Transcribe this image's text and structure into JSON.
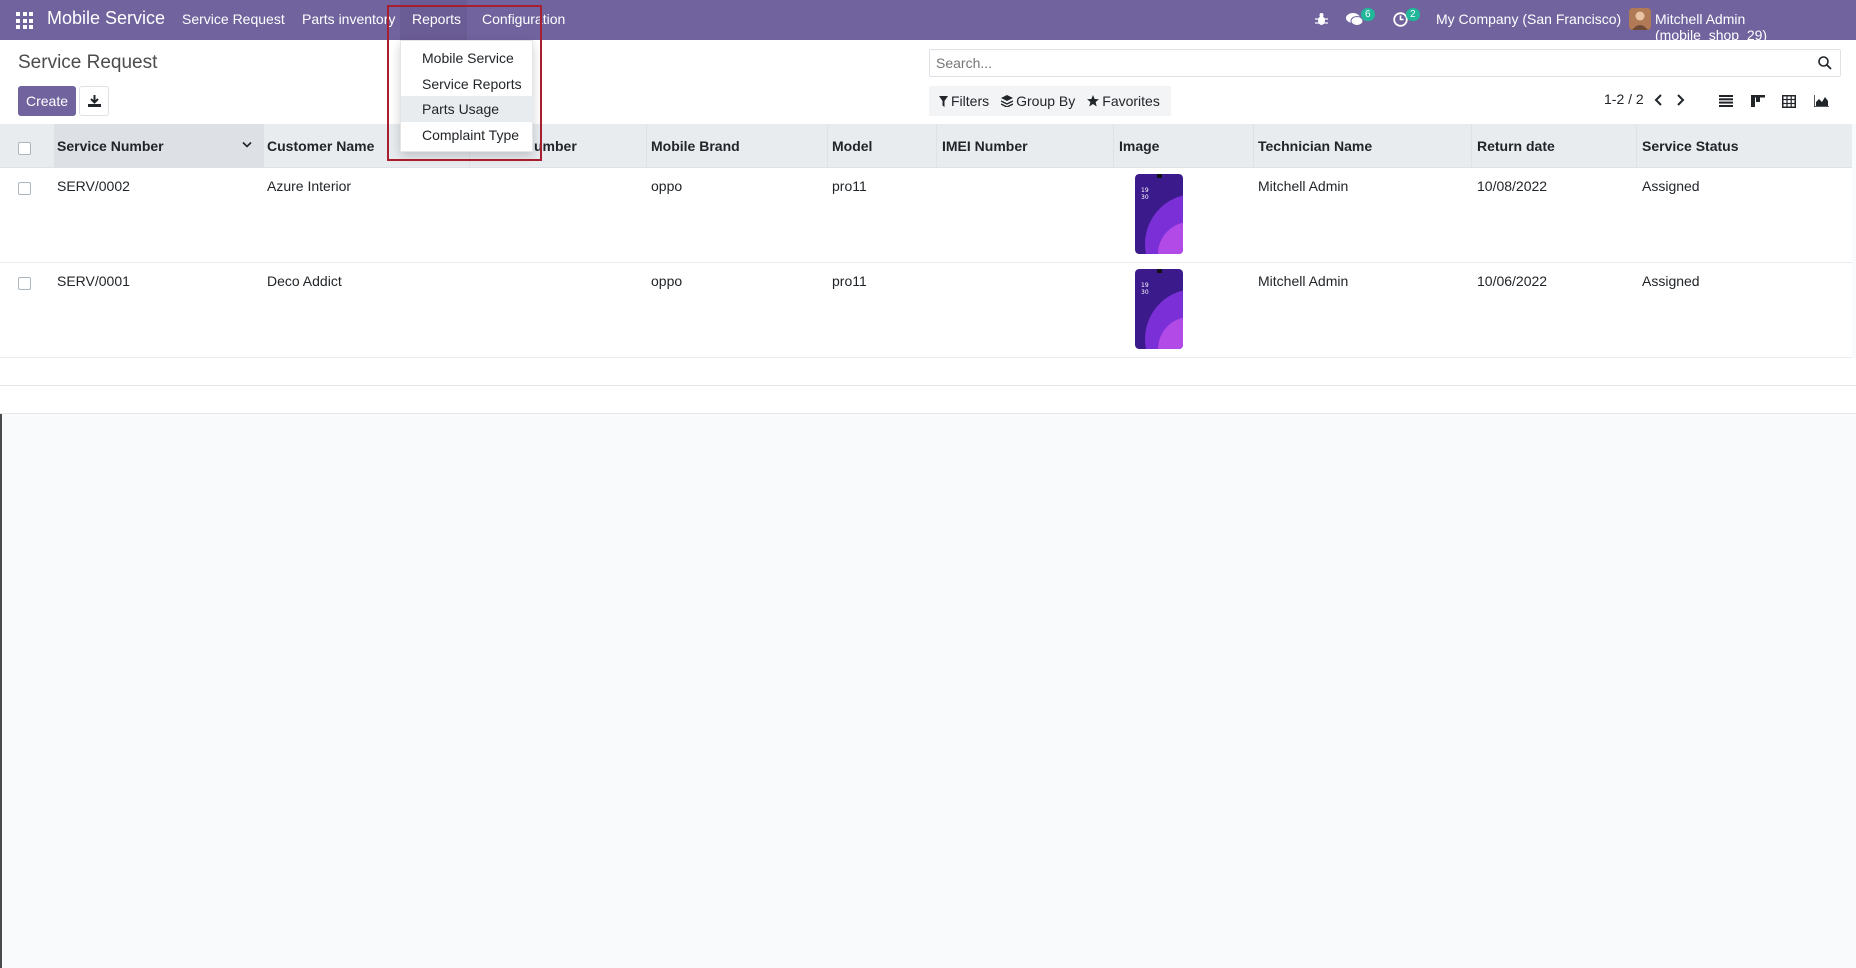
{
  "navbar": {
    "app_name": "Mobile Service",
    "menus": [
      "Service Request",
      "Parts inventory",
      "Reports",
      "Configuration"
    ],
    "messages_count": "6",
    "activities_count": "2",
    "company": "My Company (San Francisco)",
    "user": "Mitchell Admin (mobile_shop_29)"
  },
  "reports_menu": {
    "items": [
      "Mobile Service",
      "Service Reports",
      "Parts Usage",
      "Complaint Type"
    ],
    "hovered": "Parts Usage"
  },
  "control_panel": {
    "title": "Service Request",
    "create_label": "Create",
    "search_placeholder": "Search...",
    "filters_label": "Filters",
    "group_by_label": "Group By",
    "favorites_label": "Favorites",
    "pager": "1-2 / 2"
  },
  "table": {
    "columns": [
      "Service Number",
      "Customer Name",
      "umber",
      "Mobile Brand",
      "Model",
      "IMEI Number",
      "Image",
      "Technician Name",
      "Return date",
      "Service Status"
    ],
    "rows": [
      {
        "service_number": "SERV/0002",
        "customer": "Azure Interior",
        "brand": "oppo",
        "model": "pro11",
        "imei": "",
        "technician": "Mitchell Admin",
        "return_date": "10/08/2022",
        "status": "Assigned"
      },
      {
        "service_number": "SERV/0001",
        "customer": "Deco Addict",
        "brand": "oppo",
        "model": "pro11",
        "imei": "",
        "technician": "Mitchell Admin",
        "return_date": "10/06/2022",
        "status": "Assigned"
      }
    ]
  },
  "colors": {
    "navbar": "#71639e",
    "primary_button": "#71639e",
    "badge": "#21b799",
    "highlight": "#a71e2e"
  }
}
